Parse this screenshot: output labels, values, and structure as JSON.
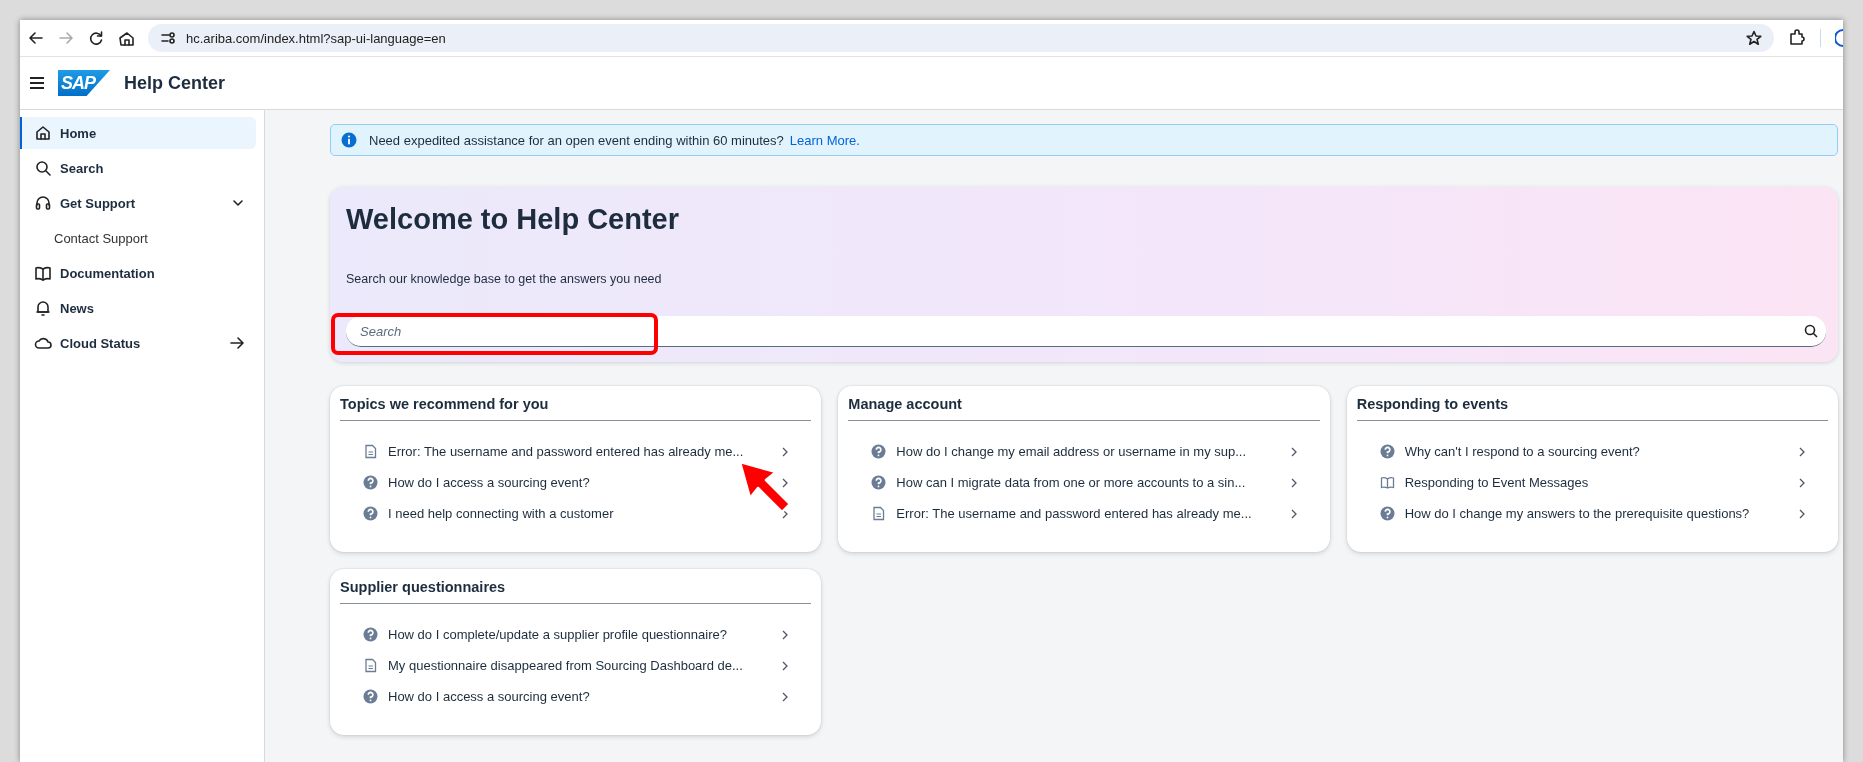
{
  "browser": {
    "url": "hc.ariba.com/index.html?sap-ui-language=en",
    "forward_disabled": true
  },
  "app_bar": {
    "logo": "SAP",
    "title": "Help Center"
  },
  "sidebar": {
    "items": [
      {
        "label": "Home",
        "kind": "home",
        "selected": true
      },
      {
        "label": "Search",
        "kind": "search",
        "selected": false
      },
      {
        "label": "Get Support",
        "kind": "support",
        "selected": false,
        "expanded": true,
        "children": [
          {
            "label": "Contact Support",
            "selected": false
          }
        ]
      },
      {
        "label": "Documentation",
        "kind": "docs",
        "selected": false
      },
      {
        "label": "News",
        "kind": "news",
        "selected": false
      },
      {
        "label": "Cloud Status",
        "kind": "external",
        "selected": false
      }
    ]
  },
  "banner": {
    "text": "Need expedited assistance for an open event ending within 60 minutes?",
    "link": "Learn More."
  },
  "welcome": {
    "title": "Welcome to Help Center",
    "subtitle": "Search our knowledge base to get the answers you need",
    "search": {
      "placeholder": "Search"
    }
  },
  "cards": [
    {
      "title": "Topics we recommend for you",
      "items": [
        {
          "kind": "document",
          "text": "Error: The username and password entered has already me..."
        },
        {
          "kind": "question",
          "text": "How do I access a sourcing event?"
        },
        {
          "kind": "question",
          "text": "I need help connecting with a customer"
        }
      ]
    },
    {
      "title": "Manage account",
      "items": [
        {
          "kind": "question",
          "text": "How do I change my email address or username in my sup..."
        },
        {
          "kind": "question",
          "text": "How can I migrate data from one or more accounts to a sin..."
        },
        {
          "kind": "document",
          "text": "Error: The username and password entered has already me..."
        }
      ]
    },
    {
      "title": "Responding to events",
      "items": [
        {
          "kind": "question",
          "text": "Why can't I respond to a sourcing event?"
        },
        {
          "kind": "book",
          "text": "Responding to Event Messages"
        },
        {
          "kind": "question",
          "text": "How do I change my answers to the prerequisite questions?"
        }
      ]
    },
    {
      "title": "Supplier questionnaires",
      "items": [
        {
          "kind": "question",
          "text": "How do I complete/update a supplier profile questionnaire?"
        },
        {
          "kind": "document",
          "text": "My questionnaire disappeared from Sourcing Dashboard de..."
        },
        {
          "kind": "question",
          "text": "How do I access a sourcing event?"
        }
      ]
    }
  ],
  "annotations": {
    "highlight_box": true,
    "arrow": true
  }
}
